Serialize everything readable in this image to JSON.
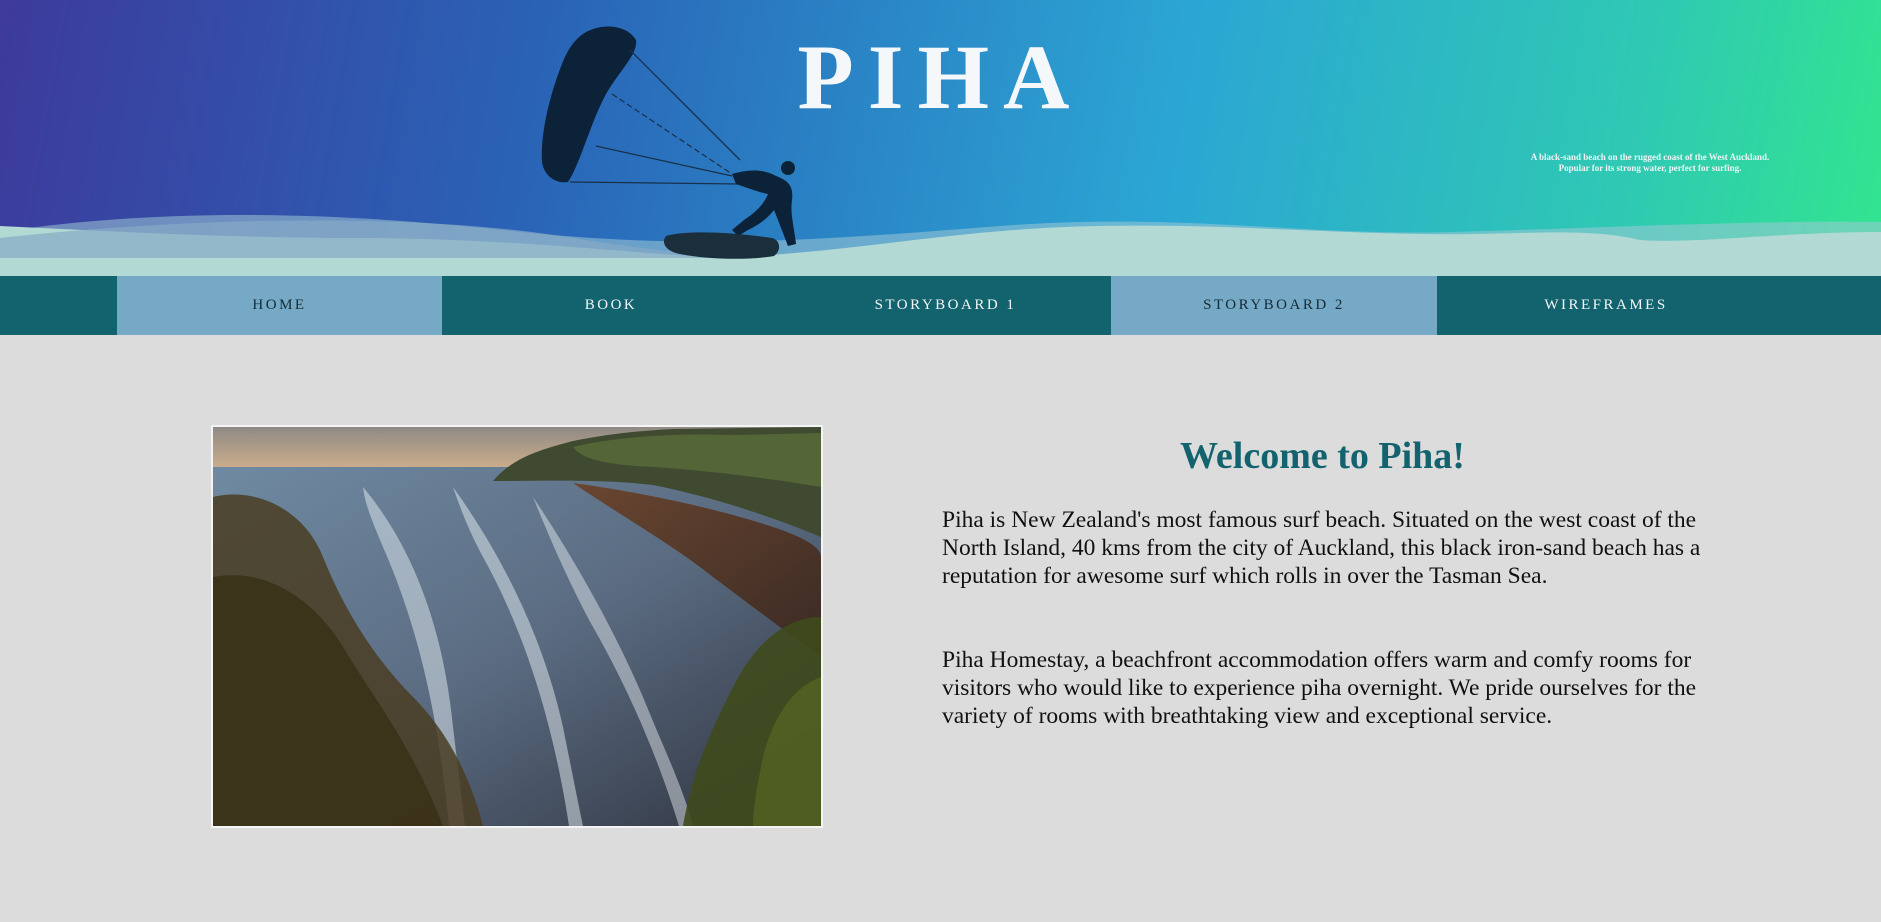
{
  "header": {
    "title": "PIHA",
    "tagline": "A black-sand beach on the rugged coast of the West Auckland. Popular for its strong water, perfect for surfing.",
    "kite_icon": "kitesurfer-silhouette-icon"
  },
  "nav": {
    "items": [
      {
        "label": "HOME",
        "style": "light"
      },
      {
        "label": "BOOK",
        "style": "dark"
      },
      {
        "label": "STORYBOARD 1",
        "style": "dark"
      },
      {
        "label": "STORYBOARD 2",
        "style": "light"
      },
      {
        "label": "WIREFRAMES",
        "style": "dark"
      }
    ]
  },
  "main": {
    "image_subject": "piha-beach-photo",
    "heading": "Welcome to Piha!",
    "paragraphs": [
      "Piha is New Zealand's most famous surf beach. Situated on the west coast of the North Island, 40 kms from the city of Auckland, this black iron-sand beach has a reputation for awesome surf which rolls in over the Tasman Sea.",
      "Piha Homestay, a beachfront accommodation offers warm and comfy rooms for visitors who would like to experience piha overnight. We pride ourselves for the variety of rooms with breathtaking view and exceptional service."
    ]
  },
  "colors": {
    "nav_dark": "#13636e",
    "nav_light": "#75a9c6",
    "heading": "#13636e",
    "page_bg": "#dcdcdc",
    "gradient_start": "#3d3a9b",
    "gradient_end": "#32e58f"
  }
}
